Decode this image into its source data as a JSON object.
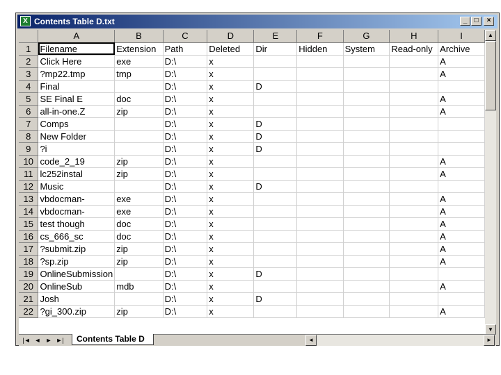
{
  "window": {
    "title": "Contents Table D.txt",
    "app_icon_text": "X",
    "btn_min": "_",
    "btn_max": "□",
    "btn_close": "×"
  },
  "columns": [
    "A",
    "B",
    "C",
    "D",
    "E",
    "F",
    "G",
    "H",
    "I"
  ],
  "rows": [
    [
      "1",
      "Filename",
      "Extension",
      "Path",
      "Deleted",
      "Dir",
      "Hidden",
      "System",
      "Read-only",
      "Archive"
    ],
    [
      "2",
      "Click Here",
      "exe",
      "D:\\",
      "x",
      "",
      "",
      "",
      "",
      "A"
    ],
    [
      "3",
      "?mp22.tmp",
      "tmp",
      "D:\\",
      "x",
      "",
      "",
      "",
      "",
      "A"
    ],
    [
      "4",
      "Final",
      "",
      "D:\\",
      "x",
      "D",
      "",
      "",
      "",
      ""
    ],
    [
      "5",
      "SE Final E",
      "doc",
      "D:\\",
      "x",
      "",
      "",
      "",
      "",
      "A"
    ],
    [
      "6",
      "all-in-one.Z",
      "zip",
      "D:\\",
      "x",
      "",
      "",
      "",
      "",
      "A"
    ],
    [
      "7",
      "Comps",
      "",
      "D:\\",
      "x",
      "D",
      "",
      "",
      "",
      ""
    ],
    [
      "8",
      "New Folder",
      "",
      "D:\\",
      "x",
      "D",
      "",
      "",
      "",
      ""
    ],
    [
      "9",
      "?i",
      "",
      "D:\\",
      "x",
      "D",
      "",
      "",
      "",
      ""
    ],
    [
      "10",
      "code_2_19",
      "zip",
      "D:\\",
      "x",
      "",
      "",
      "",
      "",
      "A"
    ],
    [
      "11",
      "lc252instal",
      "zip",
      "D:\\",
      "x",
      "",
      "",
      "",
      "",
      "A"
    ],
    [
      "12",
      "Music",
      "",
      "D:\\",
      "x",
      "D",
      "",
      "",
      "",
      ""
    ],
    [
      "13",
      "vbdocman-",
      "exe",
      "D:\\",
      "x",
      "",
      "",
      "",
      "",
      "A"
    ],
    [
      "14",
      "vbdocman-",
      "exe",
      "D:\\",
      "x",
      "",
      "",
      "",
      "",
      "A"
    ],
    [
      "15",
      "test though",
      "doc",
      "D:\\",
      "x",
      "",
      "",
      "",
      "",
      "A"
    ],
    [
      "16",
      "cs_666_sc",
      "doc",
      "D:\\",
      "x",
      "",
      "",
      "",
      "",
      "A"
    ],
    [
      "17",
      "?submit.zip",
      "zip",
      "D:\\",
      "x",
      "",
      "",
      "",
      "",
      "A"
    ],
    [
      "18",
      "?sp.zip",
      "zip",
      "D:\\",
      "x",
      "",
      "",
      "",
      "",
      "A"
    ],
    [
      "19",
      "OnlineSubmission",
      "",
      "D:\\",
      "x",
      "D",
      "",
      "",
      "",
      ""
    ],
    [
      "20",
      "OnlineSub",
      "mdb",
      "D:\\",
      "x",
      "",
      "",
      "",
      "",
      "A"
    ],
    [
      "21",
      "Josh",
      "",
      "D:\\",
      "x",
      "D",
      "",
      "",
      "",
      ""
    ],
    [
      "22",
      "?gi_300.zip",
      "zip",
      "D:\\",
      "x",
      "",
      "",
      "",
      "",
      "A"
    ]
  ],
  "sheet_tab": "Contents Table D",
  "nav": [
    "|◄",
    "◄",
    "►",
    "►|"
  ],
  "scroll": {
    "up": "▲",
    "down": "▼",
    "left": "◄",
    "right": "►"
  }
}
